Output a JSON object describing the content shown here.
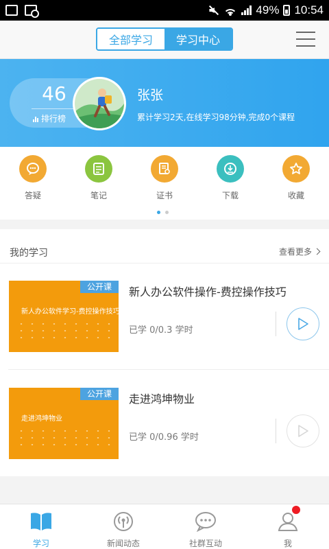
{
  "status_bar": {
    "battery": "49%",
    "time": "10:54"
  },
  "top_nav": {
    "tabs": [
      "全部学习",
      "学习中心"
    ],
    "active_tab": "学习中心"
  },
  "profile": {
    "rank_number": "46",
    "rank_label": "排行榜",
    "user_name": "张张",
    "stats": "累计学习2天,在线学习98分钟,完成0个课程"
  },
  "quick_actions": [
    {
      "label": "答疑",
      "icon": "chat-bubble-icon",
      "color": "#f2a933"
    },
    {
      "label": "笔记",
      "icon": "note-icon",
      "color": "#8bc53f"
    },
    {
      "label": "证书",
      "icon": "certificate-icon",
      "color": "#f2a933"
    },
    {
      "label": "下载",
      "icon": "download-icon",
      "color": "#3bbfbf"
    },
    {
      "label": "收藏",
      "icon": "star-icon",
      "color": "#f2a933"
    }
  ],
  "my_study": {
    "title": "我的学习",
    "more": "查看更多",
    "courses": [
      {
        "title": "新人办公软件操作-费控操作技巧",
        "tag": "公开课",
        "thumb_text": "新人办公软件学习-费控操作技巧",
        "progress": "已学 0/0.3 学时"
      },
      {
        "title": "走进鸿坤物业",
        "tag": "公开课",
        "thumb_text": "走进鸿坤物业",
        "progress": "已学 0/0.96 学时"
      }
    ]
  },
  "tab_bar": [
    {
      "label": "学习",
      "icon": "book-icon",
      "active": true
    },
    {
      "label": "新闻动态",
      "icon": "broadcast-icon",
      "active": false
    },
    {
      "label": "社群互动",
      "icon": "chat-icon",
      "active": false
    },
    {
      "label": "我",
      "icon": "person-icon",
      "active": false
    }
  ],
  "colors": {
    "accent": "#3aa7e5",
    "banner": "#37a8ef",
    "thumb": "#f39b0c",
    "badge": "#ee1c24"
  }
}
